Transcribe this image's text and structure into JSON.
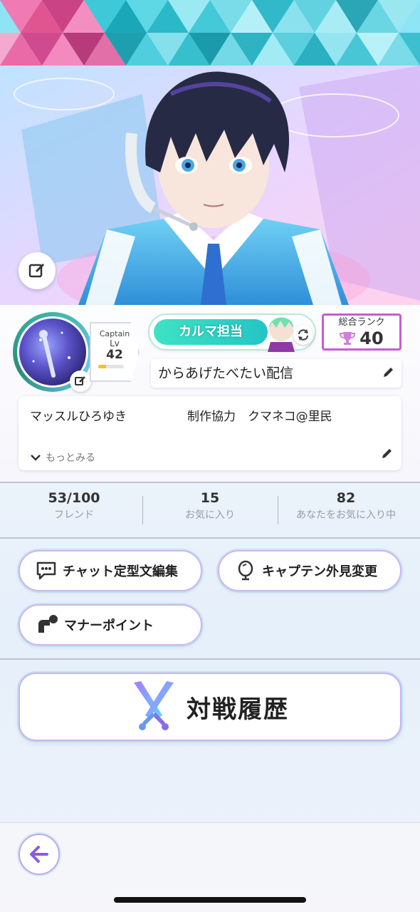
{
  "profile": {
    "level_caption": "Captain",
    "level_lv": "Lv",
    "level_value": "42",
    "level_progress": 0.3,
    "karma_label": "カルマ担当",
    "rank_label": "総合ランク",
    "rank_value": "40",
    "broadcast_title": "からあげたべたい配信",
    "bio_text": "マッスルひろゆき　　　　　制作協力　クマネコ@里民",
    "bio_more": "もっとみる"
  },
  "stats": [
    {
      "value": "53/100",
      "label": "フレンド"
    },
    {
      "value": "15",
      "label": "お気に入り"
    },
    {
      "value": "82",
      "label": "あなたをお気に入り中"
    }
  ],
  "buttons": {
    "chat_label": "チャット定型文編集",
    "captain_look_label": "キャプテン外見変更",
    "manner_label": "マナーポイント",
    "battle_history_label": "対戦履歴"
  },
  "colors": {
    "accent_purple": "#c75bd3",
    "karma_teal": "#23c5c5",
    "level_bar": "#f5c02d"
  }
}
